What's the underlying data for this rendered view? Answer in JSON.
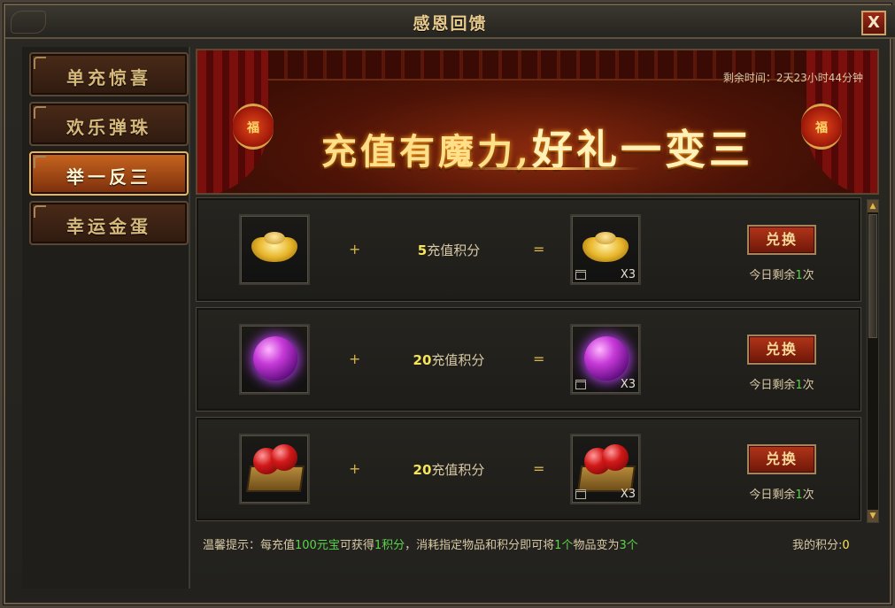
{
  "window": {
    "title": "感恩回馈",
    "close_label": "X"
  },
  "sidebar": {
    "items": [
      {
        "label": "单充惊喜",
        "active": false
      },
      {
        "label": "欢乐弹珠",
        "active": false
      },
      {
        "label": "举一反三",
        "active": true
      },
      {
        "label": "幸运金蛋",
        "active": false
      }
    ]
  },
  "banner": {
    "time_remaining": "剩余时间：2天23小时44分钟",
    "slogan_part1": "充值有魔力,",
    "slogan_part2": "好礼一变三",
    "lantern_char": "福"
  },
  "rows": [
    {
      "item": "gold-ingot",
      "plus": "+",
      "points_number": "5",
      "points_unit": "充值积分",
      "equals": "=",
      "qty": "X3",
      "button": "兑换",
      "remaining_prefix": "今日剩余",
      "remaining_count": "1",
      "remaining_suffix": "次"
    },
    {
      "item": "purple-orb",
      "plus": "+",
      "points_number": "20",
      "points_unit": "充值积分",
      "equals": "=",
      "qty": "X3",
      "button": "兑换",
      "remaining_prefix": "今日剩余",
      "remaining_count": "1",
      "remaining_suffix": "次"
    },
    {
      "item": "fruit-crate",
      "plus": "+",
      "points_number": "20",
      "points_unit": "充值积分",
      "equals": "=",
      "qty": "X3",
      "button": "兑换",
      "remaining_prefix": "今日剩余",
      "remaining_count": "1",
      "remaining_suffix": "次"
    }
  ],
  "footer": {
    "tip_prefix": "温馨提示：每充值",
    "tip_amount": "100元宝",
    "tip_mid1": "可获得",
    "tip_points": "1积分",
    "tip_mid2": "，消耗指定物品和积分即可将",
    "tip_count1": "1个",
    "tip_mid3": "物品变为",
    "tip_count2": "3个",
    "my_points_label": "我的积分:",
    "my_points_value": "0"
  },
  "colors": {
    "accent_gold": "#e7c98c",
    "highlight_green": "#5ad64a",
    "highlight_yellow": "#f6e55a",
    "button_red": "#b23418"
  },
  "icons": {
    "close": "close-icon",
    "scroll_up": "arrow-up-icon",
    "scroll_down": "arrow-down-icon",
    "lock": "bound-lock-icon"
  }
}
